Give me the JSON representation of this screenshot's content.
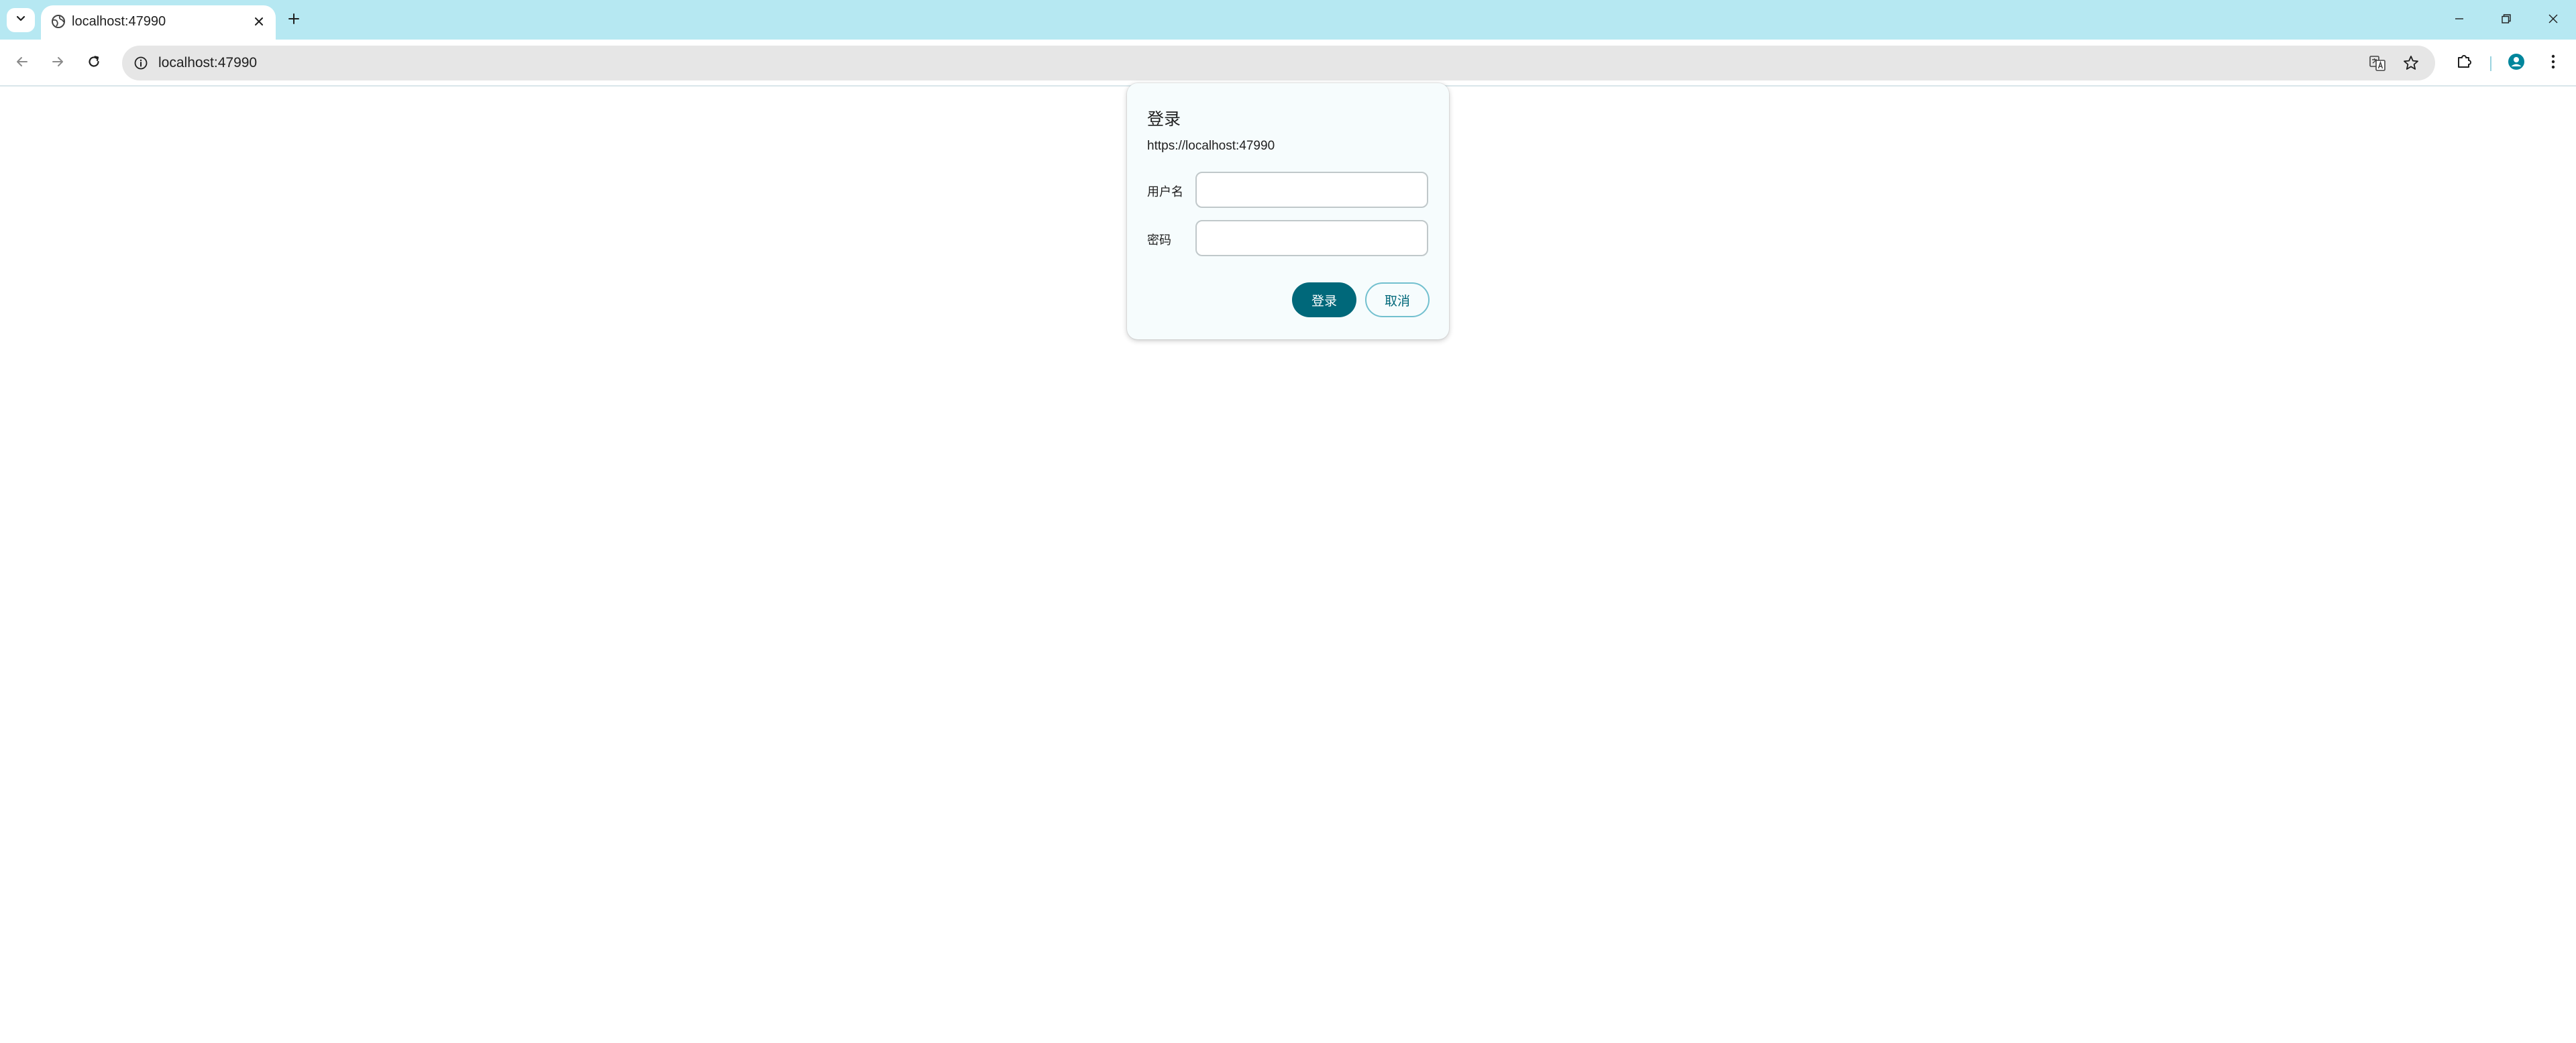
{
  "browser": {
    "tab": {
      "title": "localhost:47990"
    },
    "address_bar": {
      "url": "localhost:47990"
    }
  },
  "dialog": {
    "title": "登录",
    "origin": "https://localhost:47990",
    "username_label": "用户名",
    "username_value": "",
    "password_label": "密码",
    "password_value": "",
    "signin_button": "登录",
    "cancel_button": "取消"
  },
  "colors": {
    "tabstrip": "#b6e8f2",
    "accent": "#00687a",
    "dialog_bg": "#f6fcfd"
  }
}
